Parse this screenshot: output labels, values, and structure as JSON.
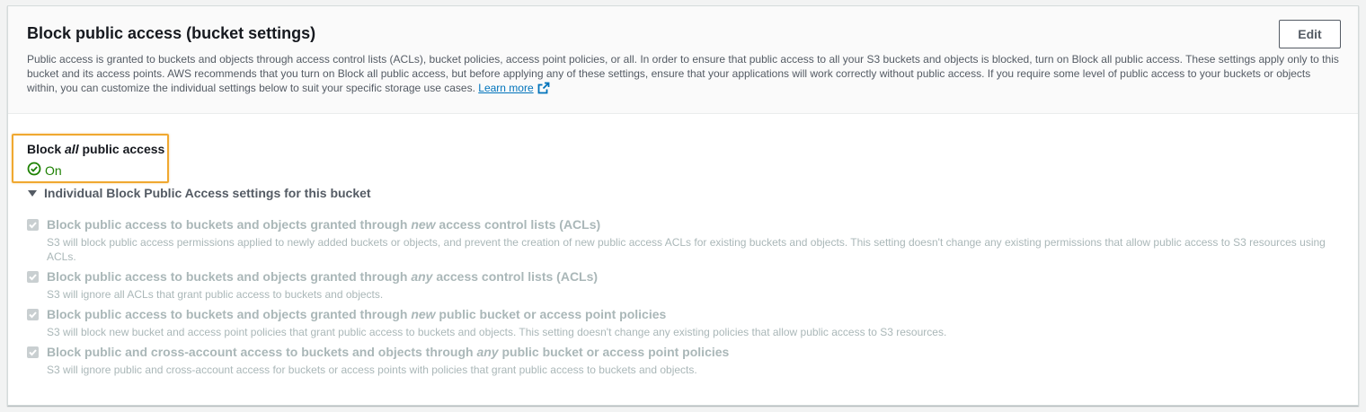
{
  "header": {
    "title": "Block public access (bucket settings)",
    "edit_label": "Edit",
    "description": "Public access is granted to buckets and objects through access control lists (ACLs), bucket policies, access point policies, or all. In order to ensure that public access to all your S3 buckets and objects is blocked, turn on Block all public access. These settings apply only to this bucket and its access points. AWS recommends that you turn on Block all public access, but before applying any of these settings, ensure that your applications will work correctly without public access. If you require some level of public access to your buckets or objects within, you can customize the individual settings below to suit your specific storage use cases.",
    "learn_more": "Learn more"
  },
  "block_all": {
    "label_prefix": "Block ",
    "label_em": "all",
    "label_suffix": " public access",
    "status": "On",
    "status_icon": "check-circle-icon"
  },
  "individual": {
    "label": "Individual Block Public Access settings for this bucket",
    "settings": [
      {
        "title_prefix": "Block public access to buckets and objects granted through ",
        "title_em": "new",
        "title_suffix": " access control lists (ACLs)",
        "description": "S3 will block public access permissions applied to newly added buckets or objects, and prevent the creation of new public access ACLs for existing buckets and objects. This setting doesn't change any existing permissions that allow public access to S3 resources using ACLs.",
        "checked": true
      },
      {
        "title_prefix": "Block public access to buckets and objects granted through ",
        "title_em": "any",
        "title_suffix": " access control lists (ACLs)",
        "description": "S3 will ignore all ACLs that grant public access to buckets and objects.",
        "checked": true
      },
      {
        "title_prefix": "Block public access to buckets and objects granted through ",
        "title_em": "new",
        "title_suffix": " public bucket or access point policies",
        "description": "S3 will block new bucket and access point policies that grant public access to buckets and objects. This setting doesn't change any existing policies that allow public access to S3 resources.",
        "checked": true
      },
      {
        "title_prefix": "Block public and cross-account access to buckets and objects through ",
        "title_em": "any",
        "title_suffix": " public bucket or access point policies",
        "description": "S3 will ignore public and cross-account access for buckets or access points with policies that grant public access to buckets and objects.",
        "checked": true
      }
    ]
  },
  "colors": {
    "link": "#0073bb",
    "success": "#1d8102",
    "highlight": "#f0a830",
    "disabled_text": "#aab7b8"
  }
}
